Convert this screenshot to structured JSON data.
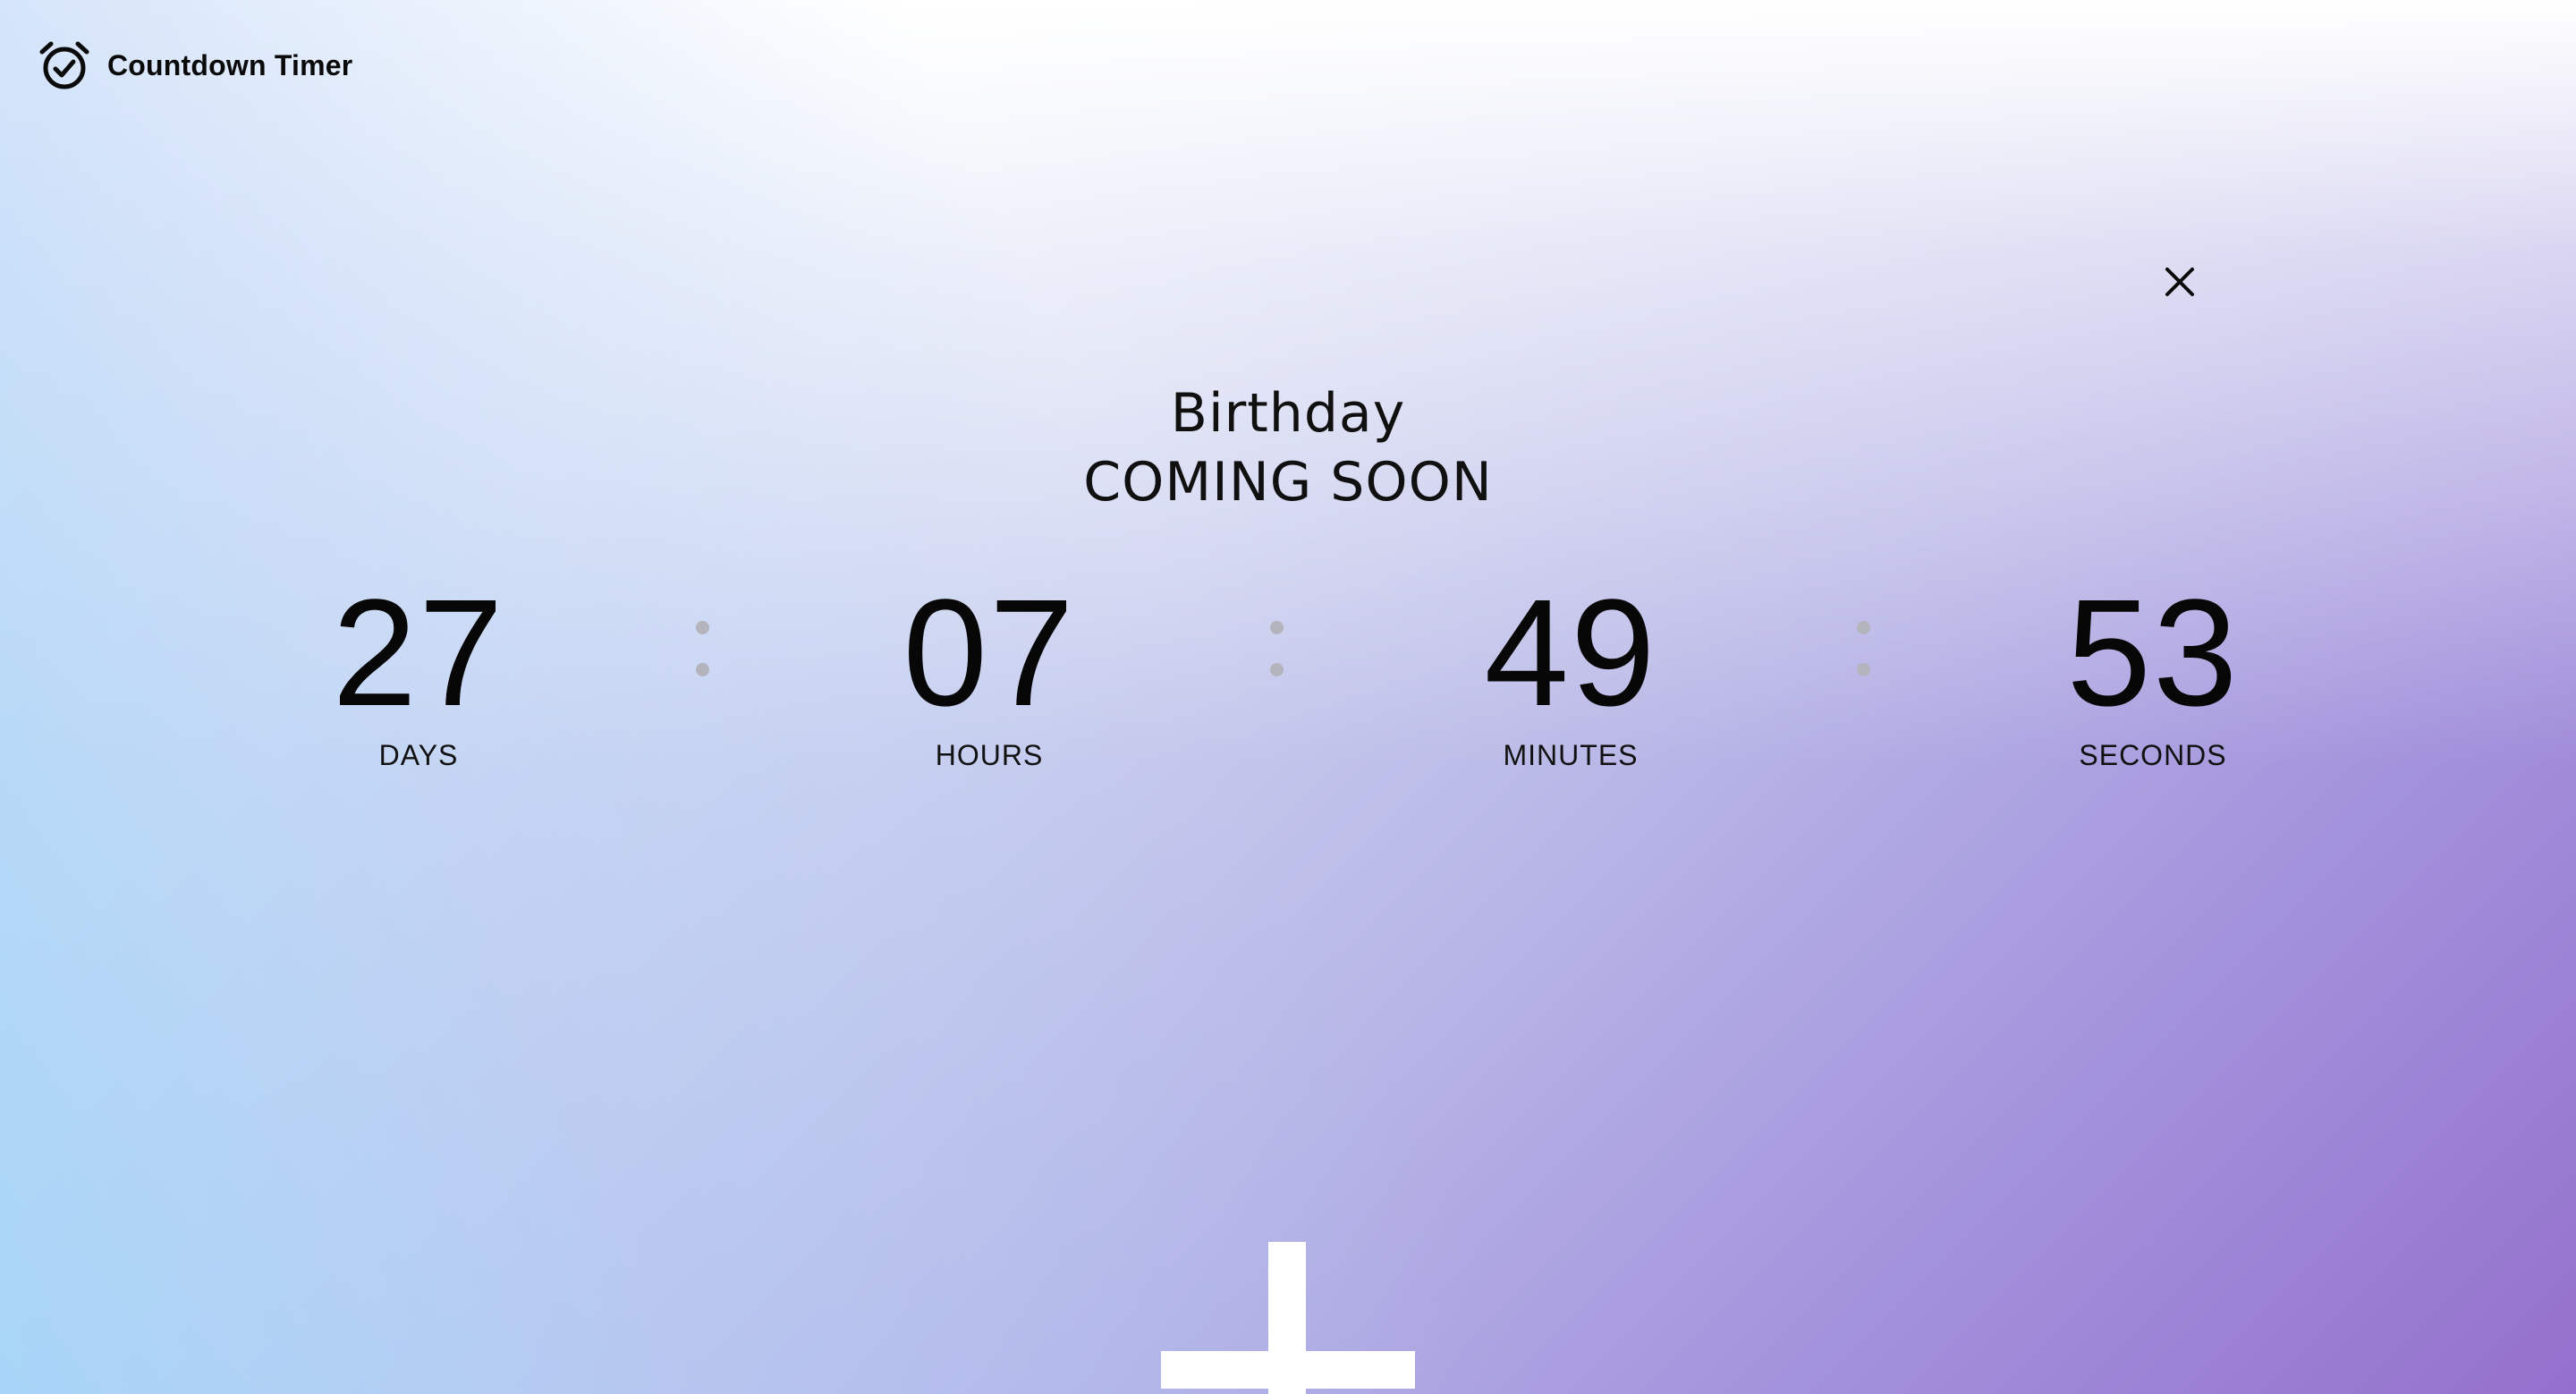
{
  "app": {
    "title": "Countdown Timer",
    "logo_icon": "alarm-clock-check-icon"
  },
  "close_icon": "close-icon",
  "event": {
    "name": "Birthday",
    "status": "COMING SOON"
  },
  "countdown": [
    {
      "value": "27",
      "label": "DAYS"
    },
    {
      "value": "07",
      "label": "HOURS"
    },
    {
      "value": "49",
      "label": "MINUTES"
    },
    {
      "value": "53",
      "label": "SECONDS"
    }
  ],
  "add_icon": "plus-icon",
  "colors": {
    "text": "#0a0a0a",
    "separator": "#b4b4bc",
    "gradient_start": "#a0d4f8",
    "gradient_end": "#9470cc",
    "add_button": "#ffffff"
  }
}
